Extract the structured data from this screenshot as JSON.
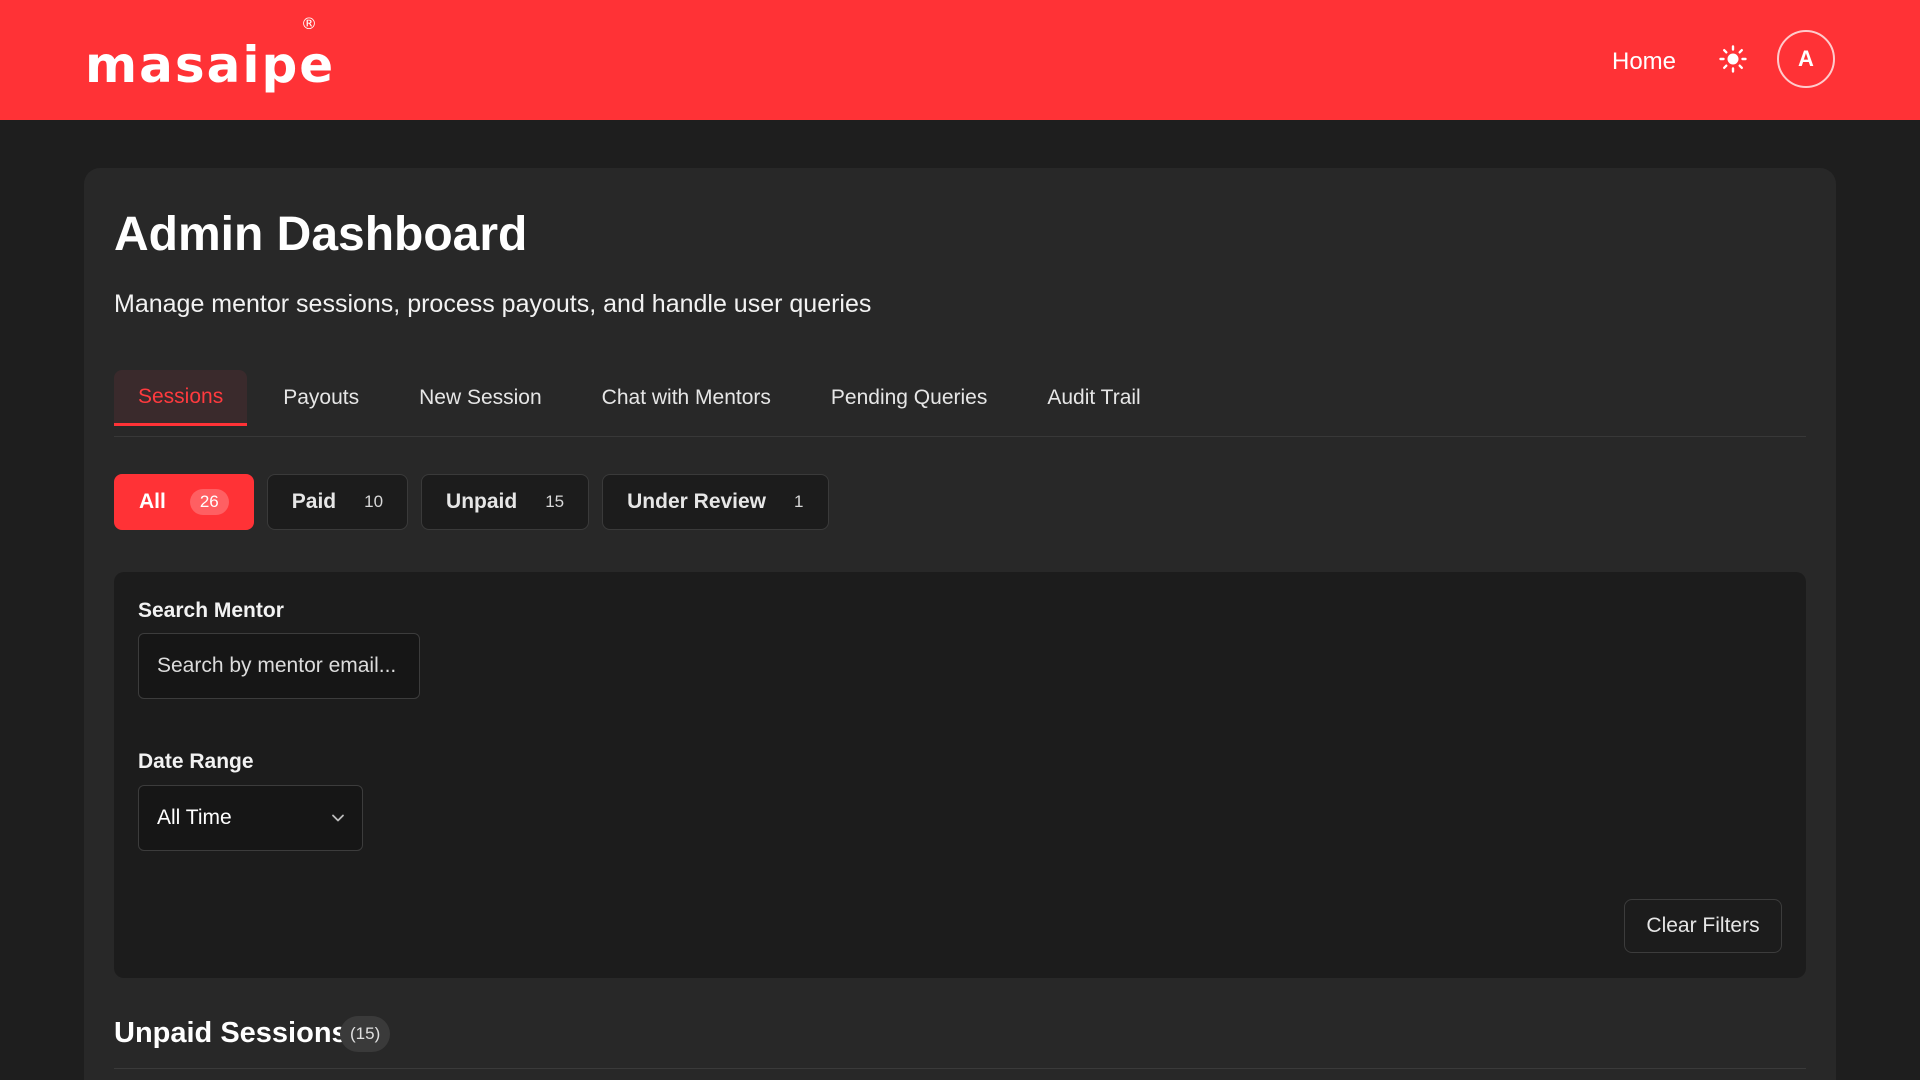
{
  "header": {
    "logo_text": "masaipe",
    "logo_mark": "®",
    "nav_home": "Home",
    "theme_icon": "sun-icon",
    "avatar_initial": "A",
    "brand_color": "#ff3236"
  },
  "page": {
    "title": "Admin Dashboard",
    "subtitle": "Manage mentor sessions, process payouts, and handle user queries"
  },
  "tabs": [
    {
      "label": "Sessions",
      "active": true
    },
    {
      "label": "Payouts"
    },
    {
      "label": "New Session"
    },
    {
      "label": "Chat with Mentors"
    },
    {
      "label": "Pending Queries"
    },
    {
      "label": "Audit Trail"
    }
  ],
  "status_filters": [
    {
      "label": "All",
      "count": "26",
      "active": true
    },
    {
      "label": "Paid",
      "count": "10"
    },
    {
      "label": "Unpaid",
      "count": "15"
    },
    {
      "label": "Under Review",
      "count": "1"
    }
  ],
  "filters": {
    "search_label": "Search Mentor",
    "search_placeholder": "Search by mentor email...",
    "date_label": "Date Range",
    "date_value": "All Time",
    "clear_label": "Clear Filters"
  },
  "section": {
    "title": "Unpaid Sessions",
    "count": "(15)"
  }
}
